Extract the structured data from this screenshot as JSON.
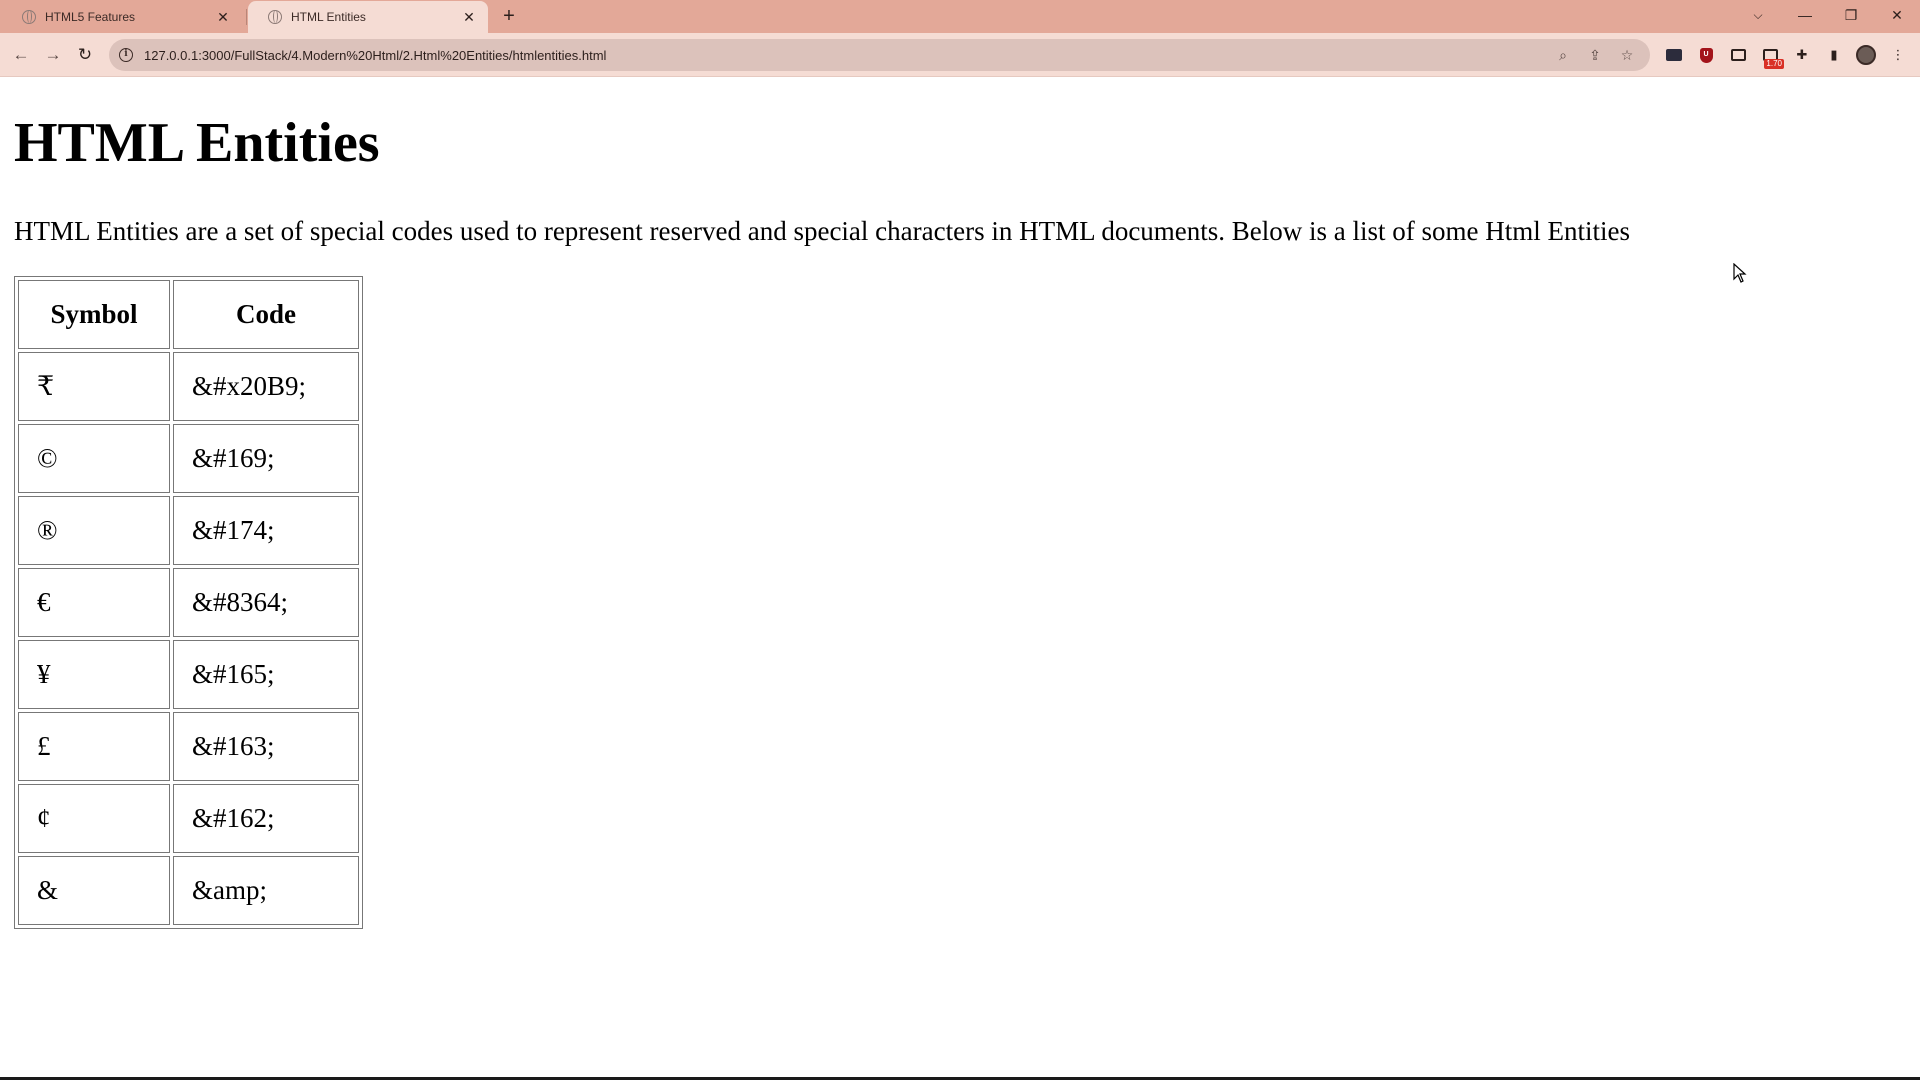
{
  "browser": {
    "tabs": [
      {
        "title": "HTML5 Features",
        "active": false
      },
      {
        "title": "HTML Entities",
        "active": true
      }
    ],
    "url": "127.0.0.1:3000/FullStack/4.Modern%20Html/2.Html%20Entities/htmlentities.html",
    "extension_badge": "1.70"
  },
  "page": {
    "heading": "HTML Entities",
    "intro": "HTML Entities are a set of special codes used to represent reserved and special characters in HTML documents. Below is a list of some Html Entities",
    "table": {
      "headers": [
        "Symbol",
        "Code"
      ],
      "rows": [
        {
          "symbol": "₹",
          "code": "&#x20B9;"
        },
        {
          "symbol": "©",
          "code": "&#169;"
        },
        {
          "symbol": "®",
          "code": "&#174;"
        },
        {
          "symbol": "€",
          "code": "&#8364;"
        },
        {
          "symbol": "¥",
          "code": "&#165;"
        },
        {
          "symbol": "£",
          "code": "&#163;"
        },
        {
          "symbol": "¢",
          "code": "&#162;"
        },
        {
          "symbol": "&",
          "code": "&amp;"
        }
      ]
    }
  }
}
